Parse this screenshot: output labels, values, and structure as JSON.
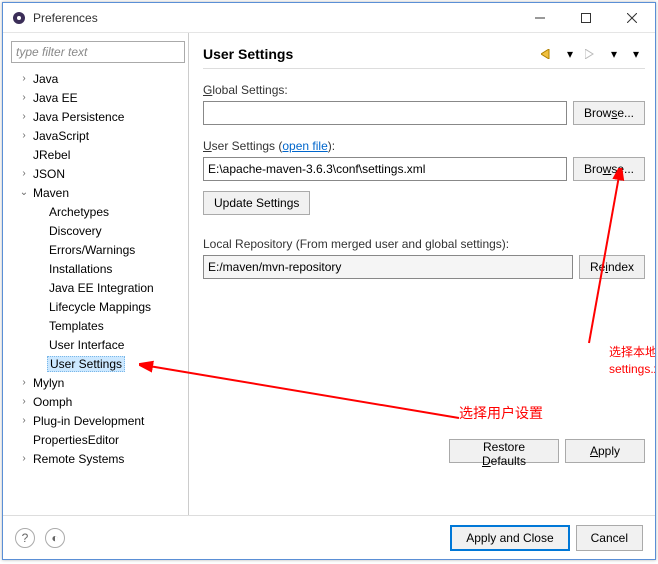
{
  "window": {
    "title": "Preferences"
  },
  "filter": {
    "placeholder": "type filter text"
  },
  "tree": {
    "items": [
      {
        "label": "Java",
        "level": 1,
        "arrow": "›"
      },
      {
        "label": "Java EE",
        "level": 1,
        "arrow": "›"
      },
      {
        "label": "Java Persistence",
        "level": 1,
        "arrow": "›"
      },
      {
        "label": "JavaScript",
        "level": 1,
        "arrow": "›"
      },
      {
        "label": "JRebel",
        "level": 1,
        "arrow": ""
      },
      {
        "label": "JSON",
        "level": 1,
        "arrow": "›"
      },
      {
        "label": "Maven",
        "level": 1,
        "arrow": "⌄"
      },
      {
        "label": "Archetypes",
        "level": 2,
        "arrow": ""
      },
      {
        "label": "Discovery",
        "level": 2,
        "arrow": ""
      },
      {
        "label": "Errors/Warnings",
        "level": 2,
        "arrow": ""
      },
      {
        "label": "Installations",
        "level": 2,
        "arrow": ""
      },
      {
        "label": "Java EE Integration",
        "level": 2,
        "arrow": ""
      },
      {
        "label": "Lifecycle Mappings",
        "level": 2,
        "arrow": ""
      },
      {
        "label": "Templates",
        "level": 2,
        "arrow": ""
      },
      {
        "label": "User Interface",
        "level": 2,
        "arrow": ""
      },
      {
        "label": "User Settings",
        "level": 2,
        "arrow": "",
        "selected": true
      },
      {
        "label": "Mylyn",
        "level": 1,
        "arrow": "›"
      },
      {
        "label": "Oomph",
        "level": 1,
        "arrow": "›"
      },
      {
        "label": "Plug-in Development",
        "level": 1,
        "arrow": "›"
      },
      {
        "label": "PropertiesEditor",
        "level": 1,
        "arrow": ""
      },
      {
        "label": "Remote Systems",
        "level": 1,
        "arrow": "›"
      }
    ]
  },
  "content": {
    "title": "User Settings",
    "global_label": "Global Settings:",
    "global_value": "",
    "browse": "Browse...",
    "user_label_pre": "User Settings (",
    "user_link": "open file",
    "user_label_post": "):",
    "user_value": "E:\\apache-maven-3.6.3\\conf\\settings.xml",
    "update_btn": "Update Settings",
    "repo_label": "Local Repository (From merged user and global settings):",
    "repo_value": "E:/maven/mvn-repository",
    "reindex": "Reindex",
    "restore": "Restore Defaults",
    "apply": "Apply"
  },
  "footer": {
    "apply_close": "Apply and Close",
    "cancel": "Cancel"
  },
  "annotations": {
    "a1": "选择用户设置",
    "a2_l1": "选择本地maven下载路径中的",
    "a2_l2": "settings.xml文件"
  }
}
